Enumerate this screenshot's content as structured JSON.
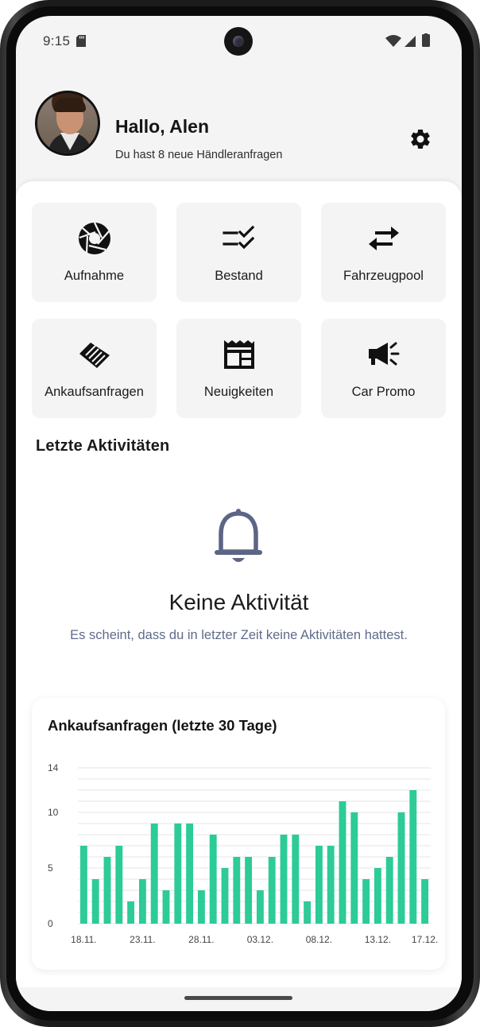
{
  "status_bar": {
    "time": "9:15",
    "icons": [
      "sd-card-icon",
      "wifi-icon",
      "signal-icon",
      "battery-icon"
    ]
  },
  "header": {
    "greeting": "Hallo, Alen",
    "subtitle": "Du hast 8 neue Händleranfragen",
    "settings_icon": "gear-icon"
  },
  "tiles": [
    {
      "label": "Aufnahme",
      "icon": "camera-aperture-icon"
    },
    {
      "label": "Bestand",
      "icon": "checklist-icon"
    },
    {
      "label": "Fahrzeugpool",
      "icon": "swap-arrows-icon"
    },
    {
      "label": "Ankaufsanfragen",
      "icon": "handshake-icon"
    },
    {
      "label": "Neuigkeiten",
      "icon": "newspaper-icon"
    },
    {
      "label": "Car Promo",
      "icon": "megaphone-icon"
    }
  ],
  "activities": {
    "title": "Letzte Aktivitäten",
    "empty_icon": "bell-icon",
    "empty_title": "Keine Aktivität",
    "empty_subtitle": "Es scheint, dass du in letzter Zeit keine Aktivitäten hattest."
  },
  "colors": {
    "bar": "#2ccb97",
    "muted_text": "#5f6b8a",
    "grid": "#e6e6e6"
  },
  "chart_data": {
    "type": "bar",
    "title": "Ankaufsanfragen (letzte 30 Tage)",
    "xlabel": "",
    "ylabel": "",
    "ylim": [
      0,
      14
    ],
    "y_ticks": [
      0,
      5,
      10,
      14
    ],
    "grid": true,
    "x_tick_labels": [
      "18.11.",
      "23.11.",
      "28.11.",
      "03.12.",
      "08.12.",
      "13.12.",
      "17.12."
    ],
    "x_tick_indices": [
      0,
      5,
      10,
      15,
      20,
      25,
      29
    ],
    "values": [
      7,
      4,
      6,
      7,
      2,
      4,
      9,
      3,
      9,
      9,
      3,
      8,
      5,
      6,
      6,
      3,
      6,
      8,
      8,
      2,
      7,
      7,
      11,
      10,
      4,
      5,
      6,
      10,
      12,
      4
    ]
  }
}
